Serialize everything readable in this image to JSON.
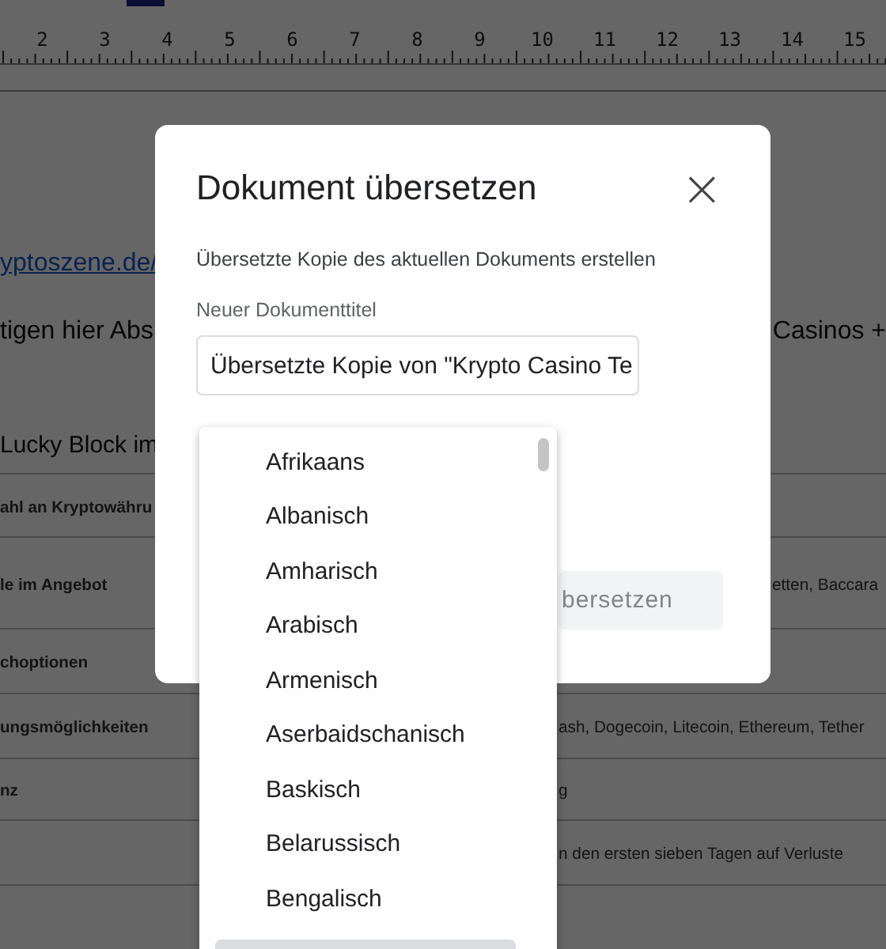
{
  "ruler": {
    "numbers": [
      "2",
      "3",
      "4",
      "5",
      "6",
      "7",
      "8",
      "9",
      "10",
      "11",
      "12",
      "13",
      "14",
      "15"
    ]
  },
  "document": {
    "link": "yptoszene.de/",
    "line": {
      "left": "tigen hier Abs",
      "right": "Casinos +"
    },
    "heading": "Lucky Block im",
    "table_rows": [
      {
        "column_1": "ahl an Kryptowähru"
      },
      {
        "column_1": "le im Angebot",
        "column_2": "etten, Baccara"
      },
      {
        "column_1": "choptionen"
      },
      {
        "column_1": "ungsmöglichkeiten",
        "column_2": "ash, Dogecoin, Litecoin, Ethereum, Tether"
      },
      {
        "column_1": "nz",
        "column_2": "g"
      },
      {
        "column_2": "n den ersten sieben Tagen auf Verluste"
      }
    ]
  },
  "dialog": {
    "title": "Dokument übersetzen",
    "close": "×",
    "subtitle": "Übersetzte Kopie des aktuellen Dokuments erstellen",
    "field_label": "Neuer Dokumenttitel",
    "title_field": {
      "value": "Übersetzte Kopie von \"Krypto Casino Te"
    },
    "button": {
      "label": "bersetzen",
      "disabled": true
    }
  },
  "language_menu": {
    "items": [
      "Afrikaans",
      "Albanisch",
      "Amharisch",
      "Arabisch",
      "Armenisch",
      "Aserbaidschanisch",
      "Baskisch",
      "Belarussisch",
      "Bengalisch"
    ]
  }
}
